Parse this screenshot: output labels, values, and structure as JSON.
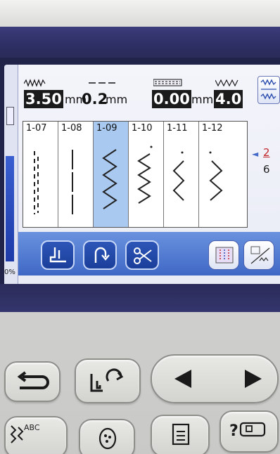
{
  "params": {
    "width": {
      "value": "3.50",
      "unit": "mm"
    },
    "length": {
      "value": "0.2",
      "unit": "mm"
    },
    "tension": {
      "value": "0.00",
      "unit": "mm"
    },
    "density": {
      "value": "4.0"
    }
  },
  "stitches": [
    {
      "code": "1-07",
      "selected": false,
      "icon": "triple-straight-stitch-icon"
    },
    {
      "code": "1-08",
      "selected": false,
      "icon": "straight-stitch-icon"
    },
    {
      "code": "1-09",
      "selected": true,
      "icon": "zigzag-stitch-icon"
    },
    {
      "code": "1-10",
      "selected": false,
      "icon": "zigzag-stitch-icon"
    },
    {
      "code": "1-11",
      "selected": false,
      "icon": "zigzag-stitch-icon"
    },
    {
      "code": "1-12",
      "selected": false,
      "icon": "zigzag-stitch-icon"
    }
  ],
  "page": {
    "current": "2",
    "total": "6"
  },
  "left_strip": {
    "percent": "0%"
  },
  "toolbar": {
    "buttons": [
      "presser-foot-icon",
      "reverse-stitch-icon",
      "scissors-icon",
      "stitch-preview-icon",
      "pattern-edit-icon"
    ]
  },
  "physical_buttons": [
    "back-icon",
    "presser-foot-needle-icon",
    "left-arrow-icon",
    "right-arrow-icon",
    "character-stitch-icon",
    "embroidery-icon",
    "memory-icon",
    "help-icon"
  ],
  "character_button": {
    "label": "ABC"
  },
  "colors": {
    "screen": "#eef0f8",
    "selected": "#a9c9f1",
    "toolbar": "#4f78cf",
    "bezel": "#2c2d60"
  }
}
